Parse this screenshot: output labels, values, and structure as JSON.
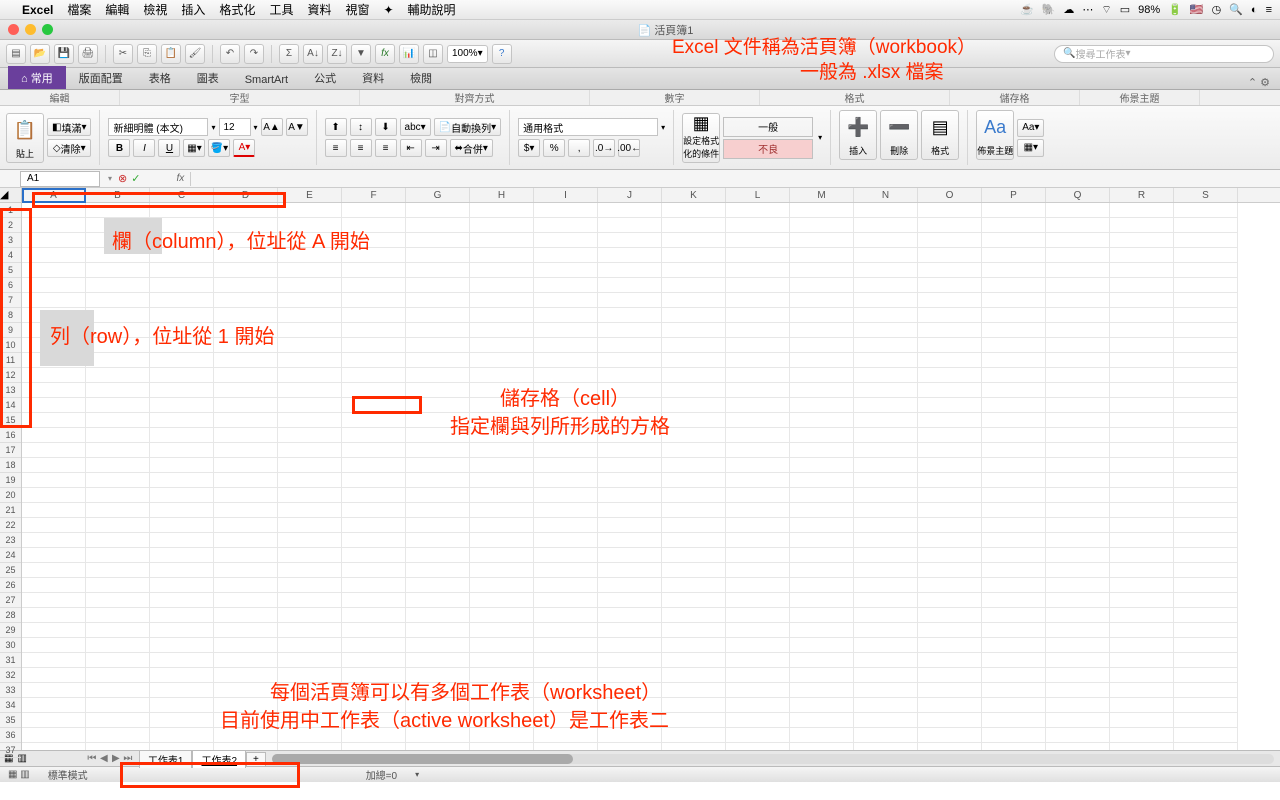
{
  "mac": {
    "app": "Excel",
    "menus": [
      "檔案",
      "編輯",
      "檢視",
      "插入",
      "格式化",
      "工具",
      "資料",
      "視窗"
    ],
    "help": "輔助說明",
    "battery": "98%"
  },
  "window": {
    "title": "活頁簿1"
  },
  "toolbar": {
    "zoom": "100%",
    "search_placeholder": "搜尋工作表"
  },
  "ribbon": {
    "tabs": [
      "常用",
      "版面配置",
      "表格",
      "圖表",
      "SmartArt",
      "公式",
      "資料",
      "檢閱"
    ],
    "active": 0,
    "groups": [
      "編輯",
      "字型",
      "對齊方式",
      "數字",
      "格式",
      "儲存格",
      "佈景主題"
    ],
    "font": {
      "name": "新細明體 (本文)",
      "size": "12"
    },
    "fill_label": "填滿",
    "clear_label": "清除",
    "paste_label": "貼上",
    "wrap_label": "自動換列",
    "merge_label": "合併",
    "number_format": "通用格式",
    "cond_label": "設定格式化的條件",
    "style_normal": "一般",
    "style_bad": "不良",
    "cells": {
      "insert": "插入",
      "delete": "刪除",
      "format": "格式"
    },
    "theme": {
      "label": "佈景主題",
      "aa": "Aa"
    }
  },
  "namebox": {
    "cell": "A1"
  },
  "columns": [
    "A",
    "B",
    "C",
    "D",
    "E",
    "F",
    "G",
    "H",
    "I",
    "J",
    "K",
    "L",
    "M",
    "N",
    "O",
    "P",
    "Q",
    "R",
    "S"
  ],
  "rows_count": 37,
  "sheets": {
    "tabs": [
      "工作表1",
      "工作表2"
    ],
    "active": 1,
    "add": "+"
  },
  "status": {
    "mode": "標準模式",
    "sum": "加總=0"
  },
  "annotations": {
    "workbook1": "Excel 文件稱為活頁簿（workbook）",
    "workbook2": "一般為 .xlsx 檔案",
    "column": "欄（column），位址從 A 開始",
    "row": "列（row），位址從 1 開始",
    "cell1": "儲存格（cell）",
    "cell2": "指定欄與列所形成的方格",
    "ws1": "每個活頁簿可以有多個工作表（worksheet）",
    "ws2": "目前使用中工作表（active worksheet）是工作表二"
  }
}
